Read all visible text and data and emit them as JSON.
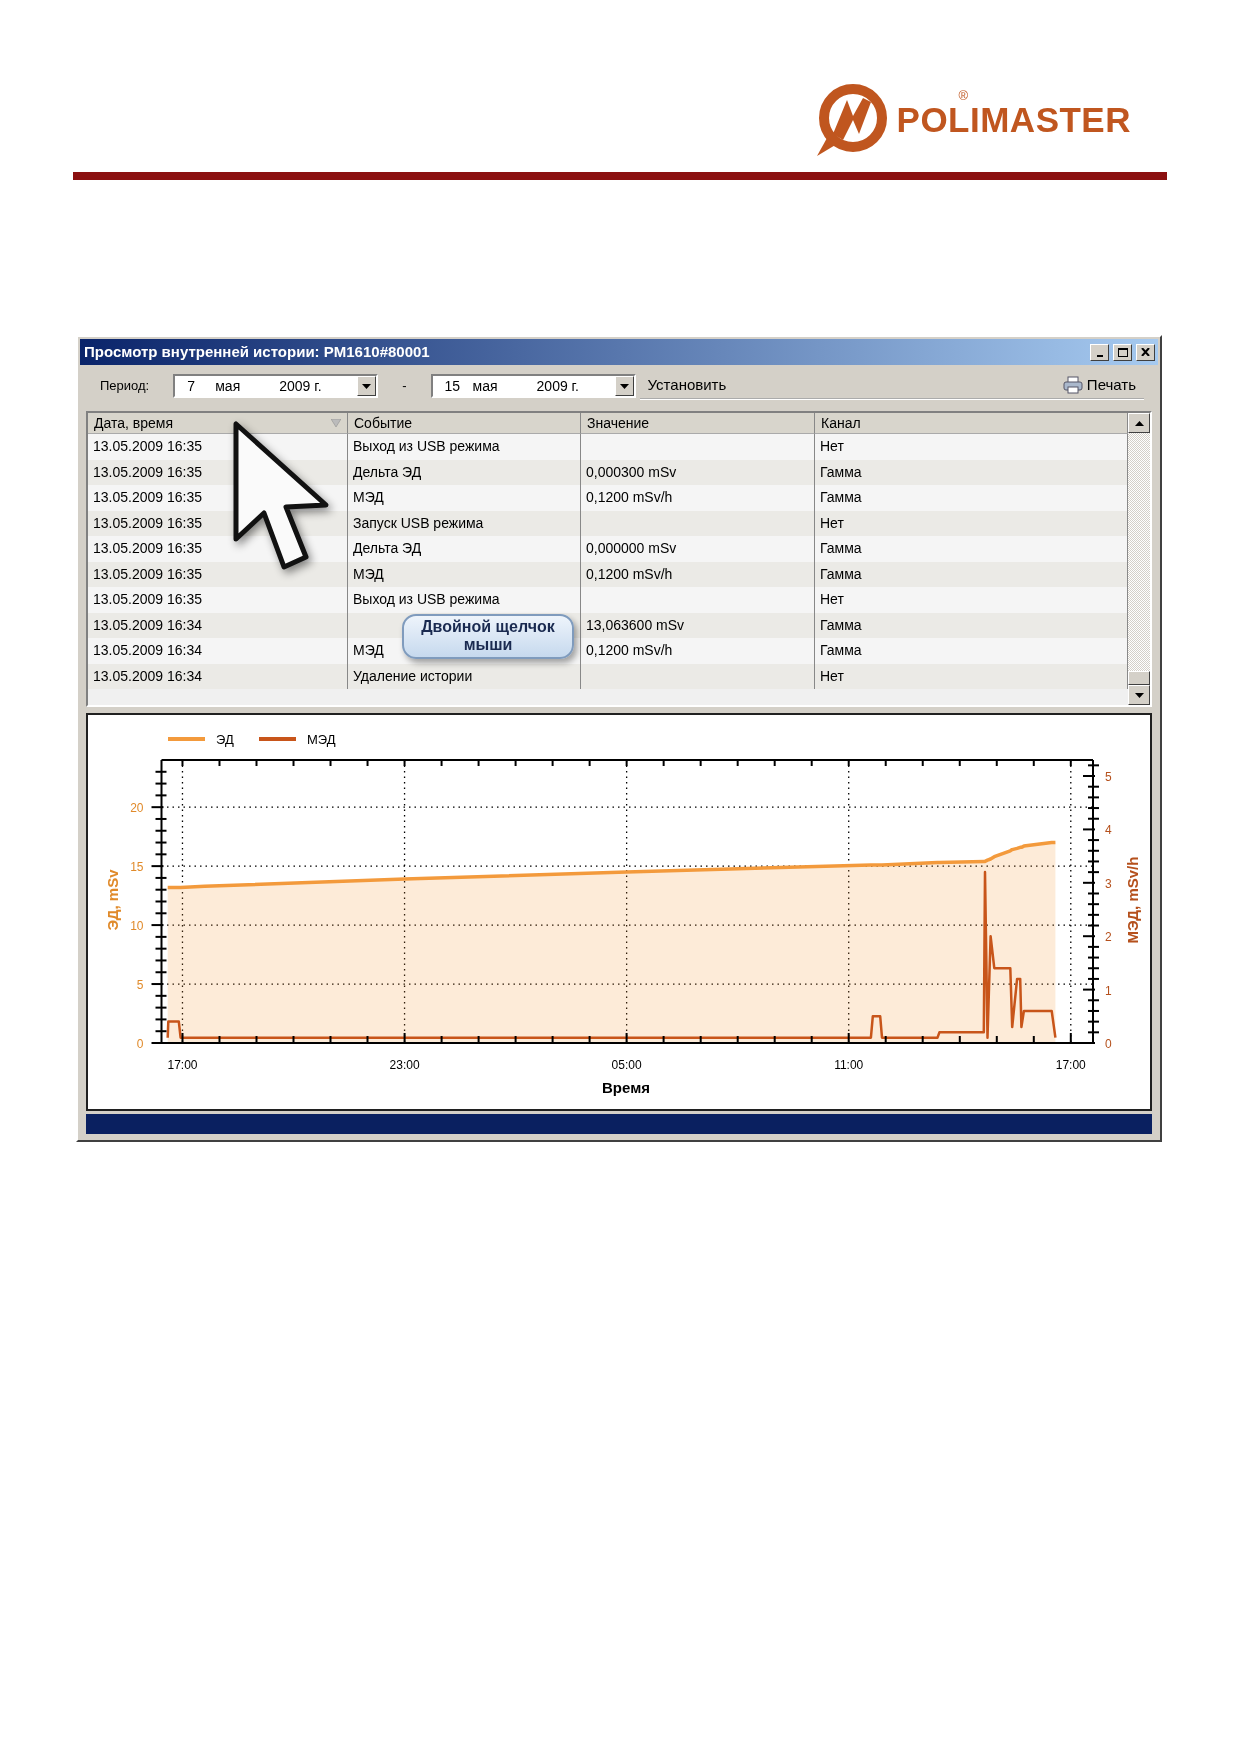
{
  "header": {
    "brand": "POLIMASTER",
    "registered_mark": "®"
  },
  "window": {
    "title": "Просмотр внутренней истории: PM1610#80001"
  },
  "toolbar": {
    "period_label": "Период:",
    "date_from": {
      "day": "7",
      "month": "мая",
      "year": "2009 г."
    },
    "separator": "-",
    "date_to": {
      "day": "15",
      "month": "мая",
      "year": "2009 г."
    },
    "buttons": [
      {
        "label": "Установить",
        "kind": "plain"
      },
      {
        "label": "Печать",
        "kind": "print"
      }
    ]
  },
  "table": {
    "columns": [
      {
        "label": "Дата, время",
        "sorted": true
      },
      {
        "label": "Событие",
        "sorted": false
      },
      {
        "label": "Значение",
        "sorted": false
      },
      {
        "label": "Канал",
        "sorted": false
      }
    ],
    "rows": [
      {
        "date": "13.05.2009 16:35",
        "event": "Выход из USB режима",
        "channel": "Нет"
      },
      {
        "date": "13.05.2009 16:35",
        "event": "Дельта ЭД",
        "value": "0,000300 mSv",
        "channel": "Гамма"
      },
      {
        "date": "13.05.2009 16:35",
        "event": "МЭД",
        "value": "0,1200 mSv/h",
        "channel": "Гамма"
      },
      {
        "date": "13.05.2009 16:35",
        "event": "Запуск USB режима",
        "channel": "Нет"
      },
      {
        "date": "13.05.2009 16:35",
        "event": "Дельта ЭД",
        "value": "0,000000 mSv",
        "channel": "Гамма"
      },
      {
        "date": "13.05.2009 16:35",
        "event": "МЭД",
        "value": "0,1200 mSv/h",
        "channel": "Гамма"
      },
      {
        "date": "13.05.2009 16:35",
        "event": "Выход из USB режима",
        "channel": "Нет"
      },
      {
        "date": "13.05.2009 16:34",
        "value": "13,063600 mSv",
        "channel": "Гамма"
      },
      {
        "date": "13.05.2009 16:34",
        "event": "МЭД",
        "value": "0,1200 mSv/h",
        "channel": "Гамма"
      },
      {
        "date": "13.05.2009 16:34",
        "event": "Удаление истории",
        "channel": "Нет"
      }
    ]
  },
  "callout": {
    "text": "Двойной щелчок мыши"
  },
  "chart": {
    "chart_data": {
      "type": "area",
      "grid": true,
      "legend": "top-left",
      "xlabel": "Время",
      "ylabel": "ЭД, mSv",
      "y2label": "МЭД, mSv/h",
      "x": [
        "2009-05-12T16:36",
        "2009-05-12T16:37",
        "2009-05-12T16:54",
        "2009-05-12T16:57",
        "2009-05-12T17:36",
        "2009-05-12T23:00",
        "2009-05-13T05:00",
        "2009-05-13T11:36",
        "2009-05-13T11:39",
        "2009-05-13T11:51",
        "2009-05-13T11:54",
        "2009-05-13T13:24",
        "2009-05-13T13:27",
        "2009-05-13T14:39",
        "2009-05-13T14:41",
        "2009-05-13T14:45",
        "2009-05-13T14:50",
        "2009-05-13T14:56",
        "2009-05-13T15:22",
        "2009-05-13T15:25",
        "2009-05-13T15:33",
        "2009-05-13T15:38",
        "2009-05-13T15:40",
        "2009-05-13T15:44",
        "2009-05-13T16:29",
        "2009-05-13T16:35"
      ],
      "series": [
        {
          "name": "ЭД",
          "color": "#f39a3c",
          "type": "area",
          "values": [
            13.2,
            13.2,
            13.2,
            13.2,
            13.3,
            13.9,
            14.5,
            15.1,
            15.1,
            15.1,
            15.1,
            15.3,
            15.3,
            15.4,
            15.4,
            15.5,
            15.6,
            15.8,
            16.3,
            16.4,
            16.5,
            16.6,
            16.6,
            16.7,
            17.0,
            17.0
          ]
        },
        {
          "name": "МЭД",
          "color": "#c8551a",
          "type": "line",
          "axis": "y2",
          "values": [
            0.1,
            0.4,
            0.4,
            0.1,
            0.1,
            0.1,
            0.1,
            0.1,
            0.5,
            0.5,
            0.1,
            0.1,
            0.2,
            0.2,
            3.2,
            0.1,
            2.0,
            1.4,
            1.4,
            0.3,
            1.2,
            1.2,
            0.3,
            0.6,
            0.6,
            0.1
          ]
        }
      ],
      "xlim": [
        "2009-05-12T16:26",
        "2009-05-13T17:36"
      ],
      "ylim": [
        0,
        24
      ],
      "y2lim": [
        0,
        5.3
      ],
      "xticks": [
        {
          "value": "2009-05-12T17:00",
          "label": "17:00"
        },
        {
          "value": "2009-05-12T23:00",
          "label": "23:00"
        },
        {
          "value": "2009-05-13T05:00",
          "label": "05:00"
        },
        {
          "value": "2009-05-13T11:00",
          "label": "11:00"
        },
        {
          "value": "2009-05-13T17:00",
          "label": "17:00"
        }
      ],
      "yticks": [
        0,
        5,
        10,
        15,
        20
      ],
      "y2ticks": [
        0,
        1,
        2,
        3,
        4,
        5
      ]
    }
  }
}
